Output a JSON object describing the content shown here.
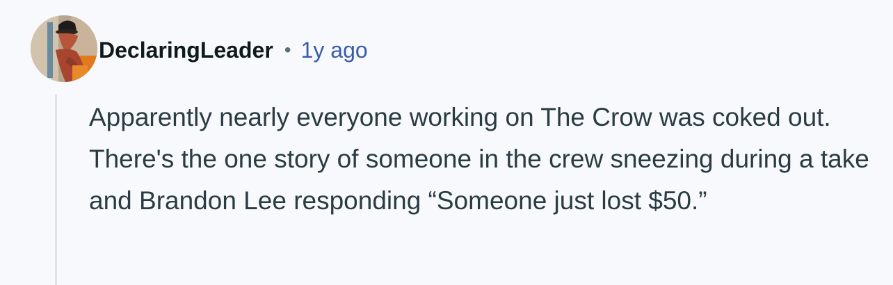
{
  "comment": {
    "author": "DeclaringLeader",
    "separator": "•",
    "timestamp": "1y ago",
    "body": "Apparently nearly everyone working on The Crow was coked out. There's the one story of someone in the crew sneezing during a take and Brandon Lee responding “Someone just lost $50.”"
  },
  "colors": {
    "background": "#f7f9fc",
    "author": "#0f1a1c",
    "timestamp": "#3a5ba8",
    "body_text": "#2a3c42",
    "thread_line": "#dde3e9"
  }
}
